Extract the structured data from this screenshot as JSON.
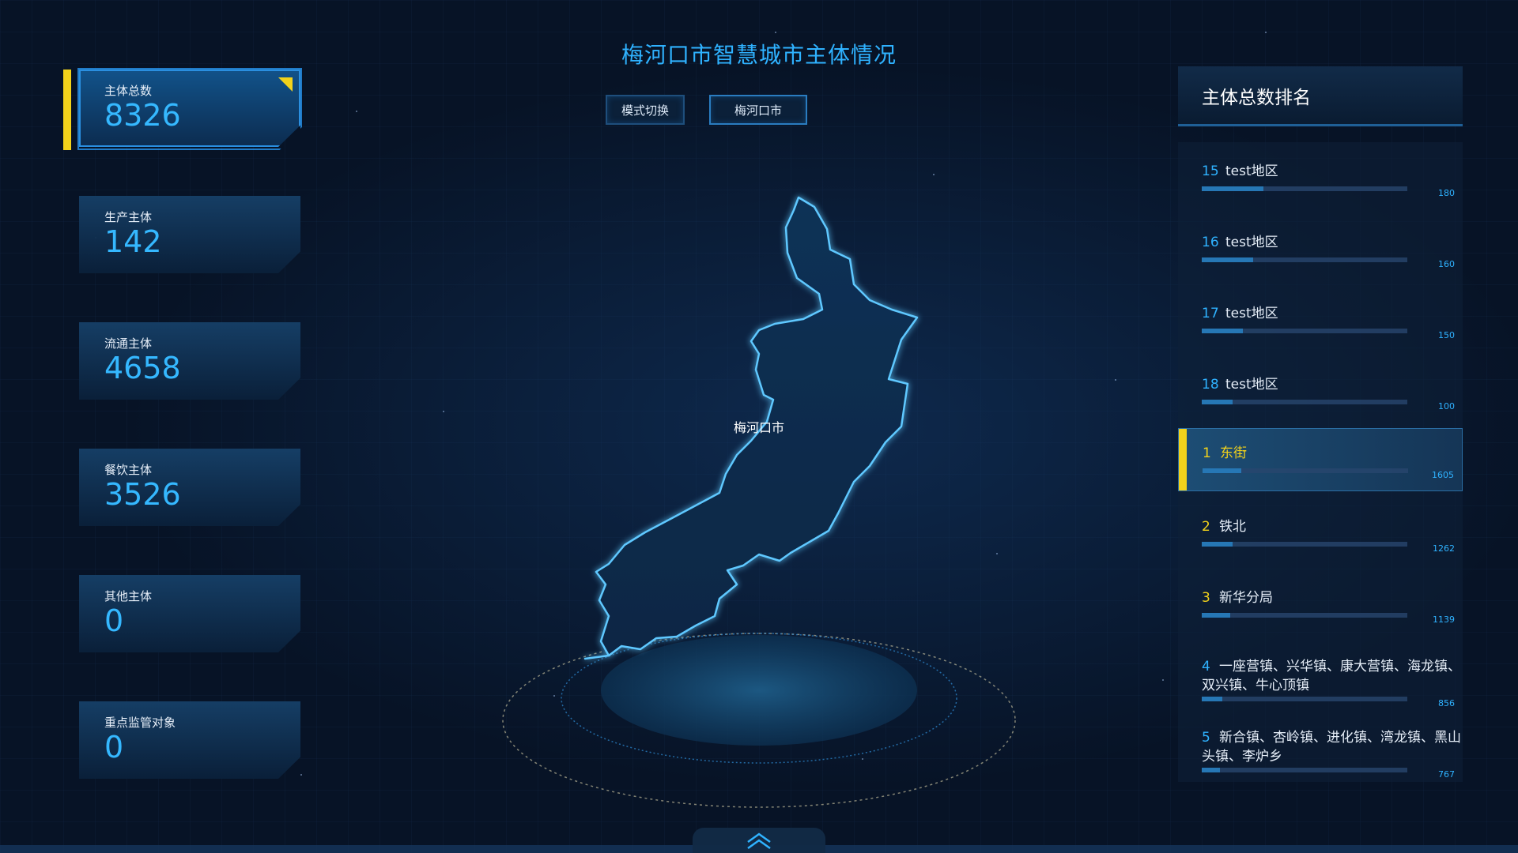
{
  "title": "梅河口市智慧城市主体情况",
  "buttons": {
    "mode_switch": "模式切换",
    "city_select": "梅河口市"
  },
  "stat_cards": [
    {
      "label": "主体总数",
      "value": "8326"
    },
    {
      "label": "生产主体",
      "value": "142"
    },
    {
      "label": "流通主体",
      "value": "4658"
    },
    {
      "label": "餐饮主体",
      "value": "3526"
    },
    {
      "label": "其他主体",
      "value": "0"
    },
    {
      "label": "重点监管对象",
      "value": "0"
    }
  ],
  "map": {
    "region_label": "梅河口市",
    "accent_color": "#2fb2ff"
  },
  "ranking": {
    "title": "主体总数排名",
    "items": [
      {
        "rank": "15",
        "name": "test地区",
        "value": "180",
        "fill": 0.3
      },
      {
        "rank": "16",
        "name": "test地区",
        "value": "160",
        "fill": 0.25
      },
      {
        "rank": "17",
        "name": "test地区",
        "value": "150",
        "fill": 0.2
      },
      {
        "rank": "18",
        "name": "test地区",
        "value": "100",
        "fill": 0.15
      },
      {
        "rank": "1",
        "name": "东街",
        "value": "1605",
        "fill": 0.19
      },
      {
        "rank": "2",
        "name": "铁北",
        "value": "1262",
        "fill": 0.15
      },
      {
        "rank": "3",
        "name": "新华分局",
        "value": "1139",
        "fill": 0.14
      },
      {
        "rank": "4",
        "name": "一座营镇、兴华镇、康大营镇、海龙镇、双兴镇、牛心顶镇",
        "value": "856",
        "fill": 0.1
      },
      {
        "rank": "5",
        "name": "新合镇、杏岭镇、进化镇、湾龙镇、黑山头镇、李炉乡",
        "value": "767",
        "fill": 0.09
      }
    ]
  },
  "colors": {
    "highlight": "#f2d21b",
    "primary": "#2fb2ff",
    "background": "#071326"
  },
  "icons": {
    "expand": "chevron-up-double-icon",
    "corner": "corner-triangle-icon"
  }
}
